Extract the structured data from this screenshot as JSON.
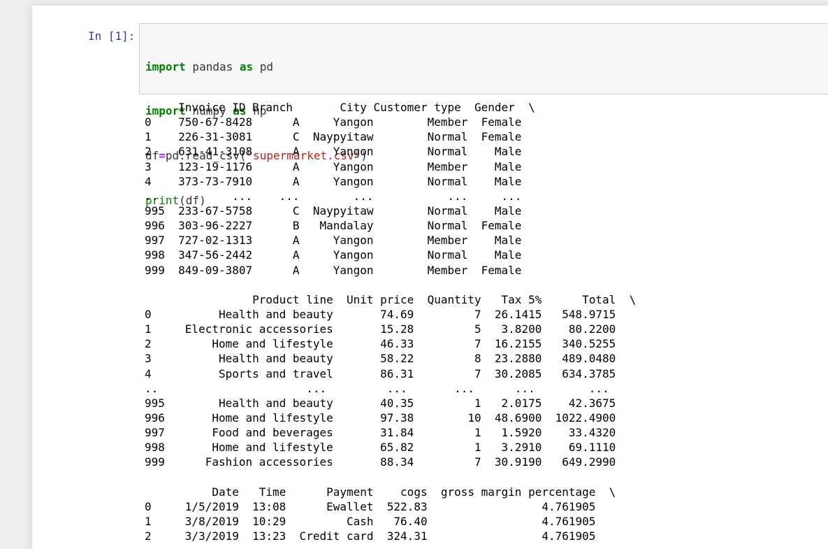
{
  "cell": {
    "prompt": "In [1]:",
    "code": {
      "line1": {
        "kw1": "import",
        "mod": " pandas ",
        "kw2": "as",
        "alias": " pd"
      },
      "line2": {
        "kw1": "import",
        "mod": " numpy ",
        "kw2": "as",
        "alias": " np"
      },
      "line3": {
        "var": "df",
        "op": "=",
        "call": "pd.read_csv(",
        "str": "\"supermarket.csv\"",
        "end": ")"
      },
      "line4": {
        "fn": "print",
        "arg": "(df)"
      }
    }
  },
  "output": {
    "block1": {
      "header": "     Invoice ID Branch       City Customer type  Gender  \\",
      "rows": [
        "0    750-67-8428      A     Yangon        Member  Female",
        "1    226-31-3081      C  Naypyitaw        Normal  Female",
        "2    631-41-3108      A     Yangon        Normal    Male",
        "3    123-19-1176      A     Yangon        Member    Male",
        "4    373-73-7910      A     Yangon        Normal    Male",
        "..           ...    ...        ...           ...     ...",
        "995  233-67-5758      C  Naypyitaw        Normal    Male",
        "996  303-96-2227      B   Mandalay        Normal  Female",
        "997  727-02-1313      A     Yangon        Member    Male",
        "998  347-56-2442      A     Yangon        Normal    Male",
        "999  849-09-3807      A     Yangon        Member  Female"
      ]
    },
    "block2": {
      "header": "                Product line  Unit price  Quantity   Tax 5%      Total  \\",
      "rows": [
        "0          Health and beauty       74.69         7  26.1415   548.9715",
        "1     Electronic accessories       15.28         5   3.8200    80.2200",
        "2         Home and lifestyle       46.33         7  16.2155   340.5255",
        "3          Health and beauty       58.22         8  23.2880   489.0480",
        "4          Sports and travel       86.31         7  30.2085   634.3785",
        "..                      ...         ...       ...      ...        ...",
        "995        Health and beauty       40.35         1   2.0175    42.3675",
        "996       Home and lifestyle       97.38        10  48.6900  1022.4900",
        "997       Food and beverages       31.84         1   1.5920    33.4320",
        "998       Home and lifestyle       65.82         1   3.2910    69.1110",
        "999      Fashion accessories       88.34         7  30.9190   649.2990"
      ]
    },
    "block3": {
      "header": "          Date   Time      Payment    cogs  gross margin percentage  \\",
      "rows": [
        "0     1/5/2019  13:08      Ewallet  522.83                 4.761905",
        "1     3/8/2019  10:29         Cash   76.40                 4.761905",
        "2     3/3/2019  13:23  Credit card  324.31                 4.761905"
      ]
    }
  }
}
